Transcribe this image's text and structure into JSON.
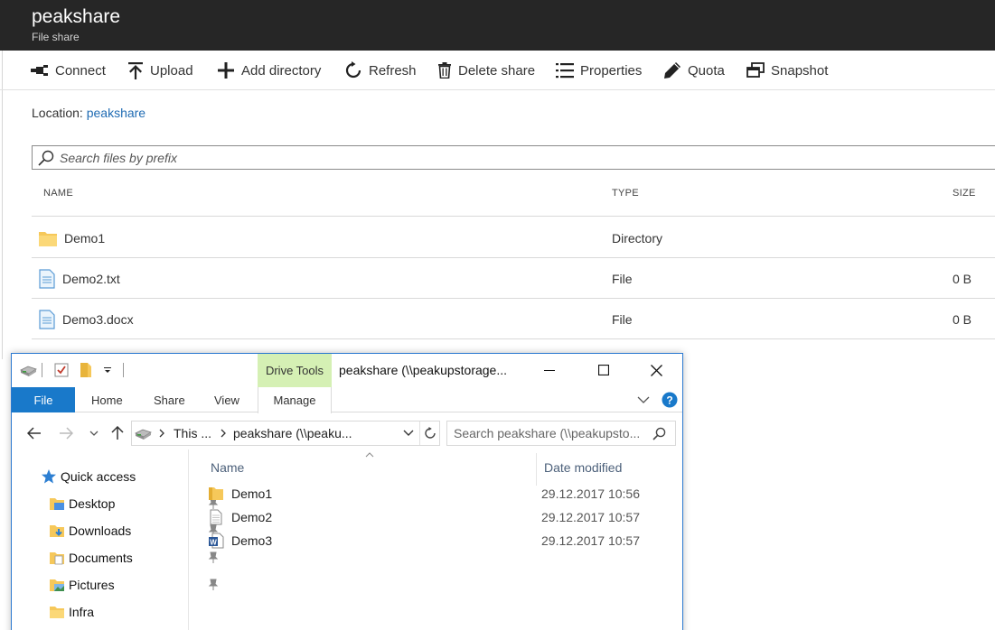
{
  "portal": {
    "title": "peakshare",
    "subtitle": "File share",
    "toolbar": {
      "connect": "Connect",
      "upload": "Upload",
      "add_directory": "Add directory",
      "refresh": "Refresh",
      "delete_share": "Delete share",
      "properties": "Properties",
      "quota": "Quota",
      "snapshot": "Snapshot"
    },
    "location_label": "Location:",
    "location_link": "peakshare",
    "search_placeholder": "Search files by prefix",
    "columns": {
      "name": "NAME",
      "type": "TYPE",
      "size": "SIZE"
    },
    "rows": [
      {
        "name": "Demo1",
        "type": "Directory",
        "size": "",
        "icon": "folder-icon"
      },
      {
        "name": "Demo2.txt",
        "type": "File",
        "size": "0 B",
        "icon": "file-icon"
      },
      {
        "name": "Demo3.docx",
        "type": "File",
        "size": "0 B",
        "icon": "file-icon"
      }
    ]
  },
  "explorer": {
    "title": "peakshare (\\\\peakupstorage...",
    "contextual_tab": "Drive Tools",
    "ribbon_tabs": {
      "file": "File",
      "home": "Home",
      "share": "Share",
      "view": "View",
      "manage": "Manage"
    },
    "address": {
      "seg1": "This ...",
      "seg2": "peakshare (\\\\peaku..."
    },
    "search_placeholder": "Search peakshare (\\\\peakupsto...",
    "nav_pane": {
      "quick_access": "Quick access",
      "items": [
        {
          "label": "Desktop",
          "icon": "desktop-folder-icon",
          "pinned": true
        },
        {
          "label": "Downloads",
          "icon": "downloads-folder-icon",
          "pinned": true
        },
        {
          "label": "Documents",
          "icon": "documents-folder-icon",
          "pinned": true
        },
        {
          "label": "Pictures",
          "icon": "pictures-folder-icon",
          "pinned": true
        },
        {
          "label": "Infra",
          "icon": "folder-icon",
          "pinned": false
        }
      ]
    },
    "columns": {
      "name": "Name",
      "date_modified": "Date modified"
    },
    "files": [
      {
        "name": "Demo1",
        "date": "29.12.2017 10:56",
        "icon": "folder-icon"
      },
      {
        "name": "Demo2",
        "date": "29.12.2017 10:57",
        "icon": "text-file-icon"
      },
      {
        "name": "Demo3",
        "date": "29.12.2017 10:57",
        "icon": "word-doc-icon"
      }
    ],
    "colors": {
      "accent": "#1979ca",
      "drive_tools": "#d5f0b4",
      "header_text": "#4c607a"
    }
  },
  "colors": {
    "portal_header": "#262626",
    "link": "#1f6bb3"
  }
}
